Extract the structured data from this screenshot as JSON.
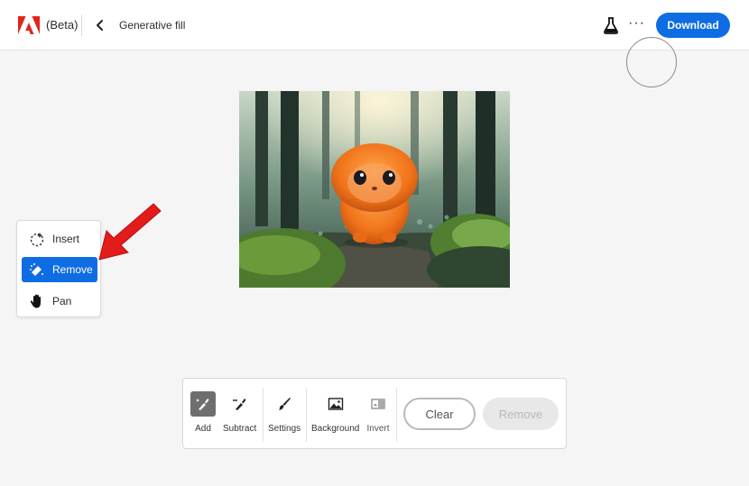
{
  "header": {
    "beta_label": "(Beta)",
    "title": "Generative fill",
    "download_label": "Download",
    "more_label": "···"
  },
  "tools": {
    "items": [
      {
        "label": "Insert",
        "icon": "insert-icon",
        "active": false
      },
      {
        "label": "Remove",
        "icon": "eraser-icon",
        "active": true
      },
      {
        "label": "Pan",
        "icon": "hand-icon",
        "active": false
      }
    ]
  },
  "toolbar": {
    "add_label": "Add",
    "subtract_label": "Subtract",
    "settings_label": "Settings",
    "background_label": "Background",
    "invert_label": "Invert",
    "clear_label": "Clear",
    "remove_label": "Remove"
  },
  "colors": {
    "accent": "#0f6de3",
    "adobe_red": "#e1251b",
    "arrow_red": "#e31b1b"
  }
}
